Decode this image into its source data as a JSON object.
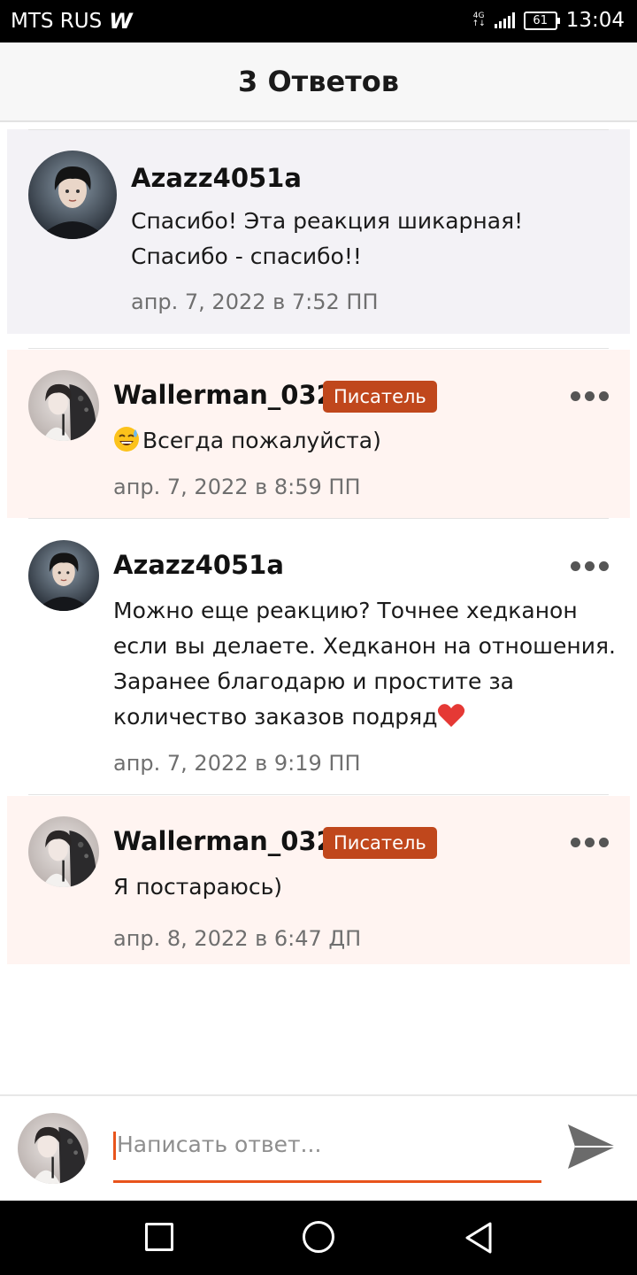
{
  "status_bar": {
    "carrier": "MTS RUS",
    "app_icon": "W",
    "network": "4G",
    "battery": "61",
    "time": "13:04"
  },
  "header": {
    "title": "3 Ответов"
  },
  "comments": [
    {
      "author": "Azazz4051a",
      "lines": [
        "Спасибо! Эта реакция шикарная!",
        "Спасибо - спасибо!!"
      ],
      "time": "апр. 7, 2022 в 7:52 ПП"
    },
    {
      "author": "Wallerman_032",
      "badge": "Писатель",
      "emoji": "sweat-smile-emoji",
      "lines": [
        "Всегда пожалуйста)"
      ],
      "time": "апр. 7, 2022 в 8:59 ПП"
    },
    {
      "author": "Azazz4051a",
      "emoji_end": "red-heart-emoji",
      "lines": [
        "Можно еще реакцию? Точнее хедканон",
        "если вы делаете. Хедканон на отношения.",
        "Заранее благодарю и простите за",
        "количество заказов подряд"
      ],
      "time": "апр. 7, 2022 в 9:19 ПП"
    },
    {
      "author": "Wallerman_032",
      "badge": "Писатель",
      "lines": [
        "Я постараюсь)"
      ],
      "time": "апр. 8, 2022 в 6:47 ДП"
    }
  ],
  "reply": {
    "placeholder": "Написать ответ..."
  },
  "colors": {
    "accent": "#e8541c",
    "badge": "#c0471c",
    "highlight_bg": "#fff4f1",
    "parent_bg": "#f3f2f6"
  },
  "icons": [
    "more-options-icon",
    "send-icon",
    "nav-back-icon",
    "nav-home-icon",
    "nav-recent-apps-icon"
  ]
}
